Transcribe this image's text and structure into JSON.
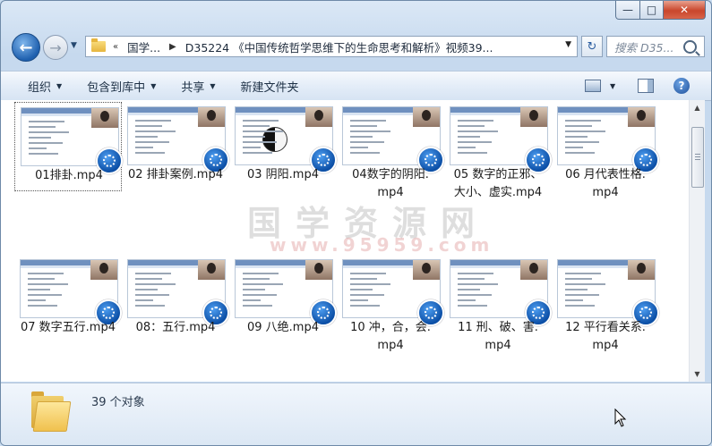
{
  "window": {
    "caption_buttons": {
      "minimize": "—",
      "maximize": "□",
      "close": "✕"
    }
  },
  "nav": {
    "back_glyph": "←",
    "forward_glyph": "→",
    "breadcrumb_prefix": "«",
    "breadcrumbs": [
      "国学...",
      "D35224 《中国传统哲学思维下的生命思考和解析》视频39..."
    ],
    "separator": "▶",
    "refresh_glyph": "↻",
    "search_placeholder": "搜索 D35..."
  },
  "toolbar": {
    "organize": "组织",
    "include_in_library": "包含到库中",
    "share": "共享",
    "new_folder": "新建文件夹"
  },
  "files": [
    {
      "name": "01排卦.mp4",
      "selected": true
    },
    {
      "name": "02 排卦案例.mp4"
    },
    {
      "name": "03 阴阳.mp4"
    },
    {
      "name": "04数字的阴阳.mp4"
    },
    {
      "name": "05 数字的正邪、大小、虚实.mp4"
    },
    {
      "name": "06 月代表性格.mp4"
    },
    {
      "name": "07 数字五行.mp4"
    },
    {
      "name": "08：五行.mp4"
    },
    {
      "name": "09 八绝.mp4"
    },
    {
      "name": "10 冲，合，会.mp4"
    },
    {
      "name": "11 刑、破、害.mp4"
    },
    {
      "name": "12 平行看关系.mp4"
    }
  ],
  "file_labels_wrapped": [
    [
      "01排卦.mp4"
    ],
    [
      "02 排卦案例.mp4"
    ],
    [
      "03 阴阳.mp4"
    ],
    [
      "04数字的阴阳.",
      "mp4"
    ],
    [
      "05 数字的正邪、",
      "大小、虚实.mp4"
    ],
    [
      "06 月代表性格.",
      "mp4"
    ],
    [
      "07 数字五行.mp4"
    ],
    [
      "08：五行.mp4"
    ],
    [
      "09 八绝.mp4"
    ],
    [
      "10 冲，合，会.",
      "mp4"
    ],
    [
      "11 刑、破、害.",
      "mp4"
    ],
    [
      "12 平行看关系.",
      "mp4"
    ]
  ],
  "watermark": {
    "text": "国学资源网",
    "url": "www.95959.com"
  },
  "details": {
    "count_text": "39 个对象"
  },
  "colors": {
    "accent": "#1e5fae",
    "selection_border": "#555555"
  }
}
